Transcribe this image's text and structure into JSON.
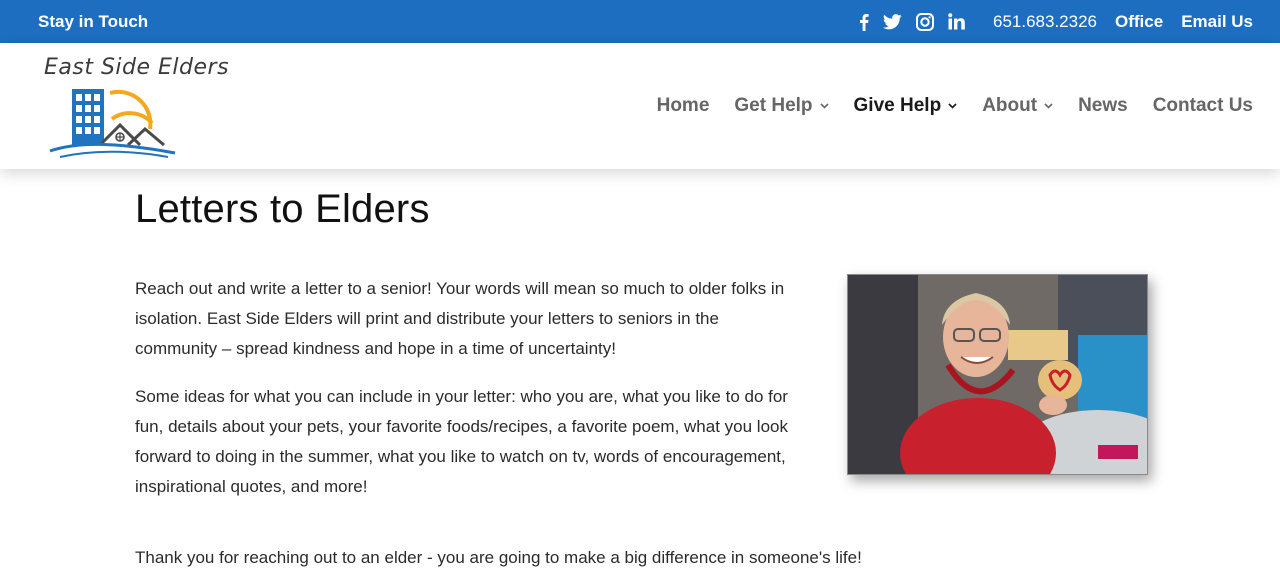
{
  "topbar": {
    "stay_label": "Stay in Touch",
    "social_icons": [
      "facebook-icon",
      "twitter-icon",
      "instagram-icon",
      "linkedin-icon"
    ],
    "phone": "651.683.2326",
    "office_label": "Office",
    "email_label": "Email Us",
    "background_color": "#1d6ec0"
  },
  "logo": {
    "text": "East Side Elders"
  },
  "nav": {
    "items": [
      {
        "label": "Home",
        "has_dropdown": false,
        "active": false
      },
      {
        "label": "Get Help",
        "has_dropdown": true,
        "active": false
      },
      {
        "label": "Give Help",
        "has_dropdown": true,
        "active": true
      },
      {
        "label": "About",
        "has_dropdown": true,
        "active": false
      },
      {
        "label": "News",
        "has_dropdown": false,
        "active": false
      },
      {
        "label": "Contact Us",
        "has_dropdown": false,
        "active": false
      }
    ]
  },
  "main": {
    "title": "Letters to Elders",
    "paragraph1": "Reach out and write a letter to a senior!  Your words will mean so much to older folks in isolation.  East Side Elders will print and distribute your letters to seniors in the community – spread kindness and hope in a time of uncertainty!",
    "paragraph2": "Some ideas for what you can include in your letter:  who you are, what you like to do for fun, details about your pets, your favorite foods/recipes, a favorite poem, what you look forward to doing in the summer, what you like to watch on tv, words of encouragement, inspirational quotes, and more!",
    "paragraph3": "Thank you for reaching out to an elder - you are going to make a big difference in someone's life!"
  }
}
